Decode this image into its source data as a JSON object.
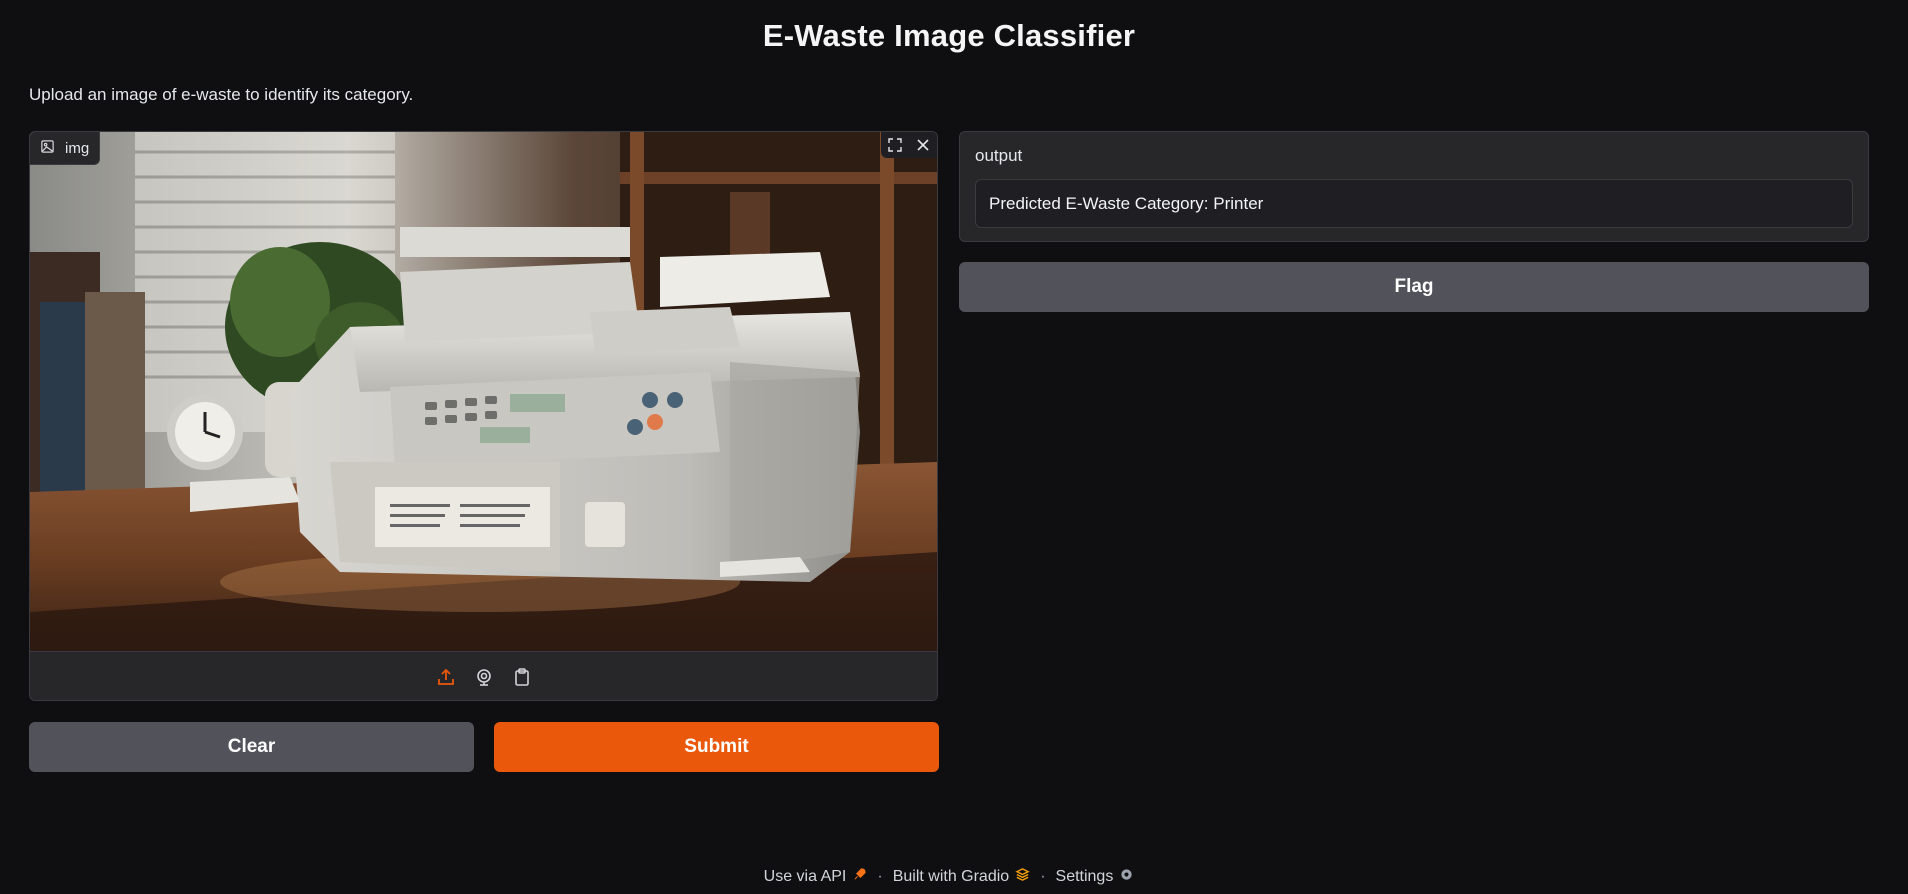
{
  "header": {
    "title": "E-Waste Image Classifier",
    "description": "Upload an image of e-waste to identify its category."
  },
  "image_input": {
    "label": "img",
    "label_icon": "image-icon",
    "fullscreen_icon": "fullscreen-icon",
    "close_icon": "close-icon",
    "sources": [
      "upload-icon",
      "webcam-icon",
      "clipboard-icon"
    ],
    "image_alt": "Printer on wooden desk"
  },
  "output": {
    "label": "output",
    "value": "Predicted E-Waste Category: Printer"
  },
  "buttons": {
    "clear": "Clear",
    "submit": "Submit",
    "flag": "Flag"
  },
  "footer": {
    "api": "Use via API",
    "built": "Built with Gradio",
    "settings": "Settings",
    "separator": "·"
  },
  "colors": {
    "background": "#0f0f11",
    "primary": "#ea580c",
    "secondary": "#52525b",
    "panel": "#27272a"
  }
}
